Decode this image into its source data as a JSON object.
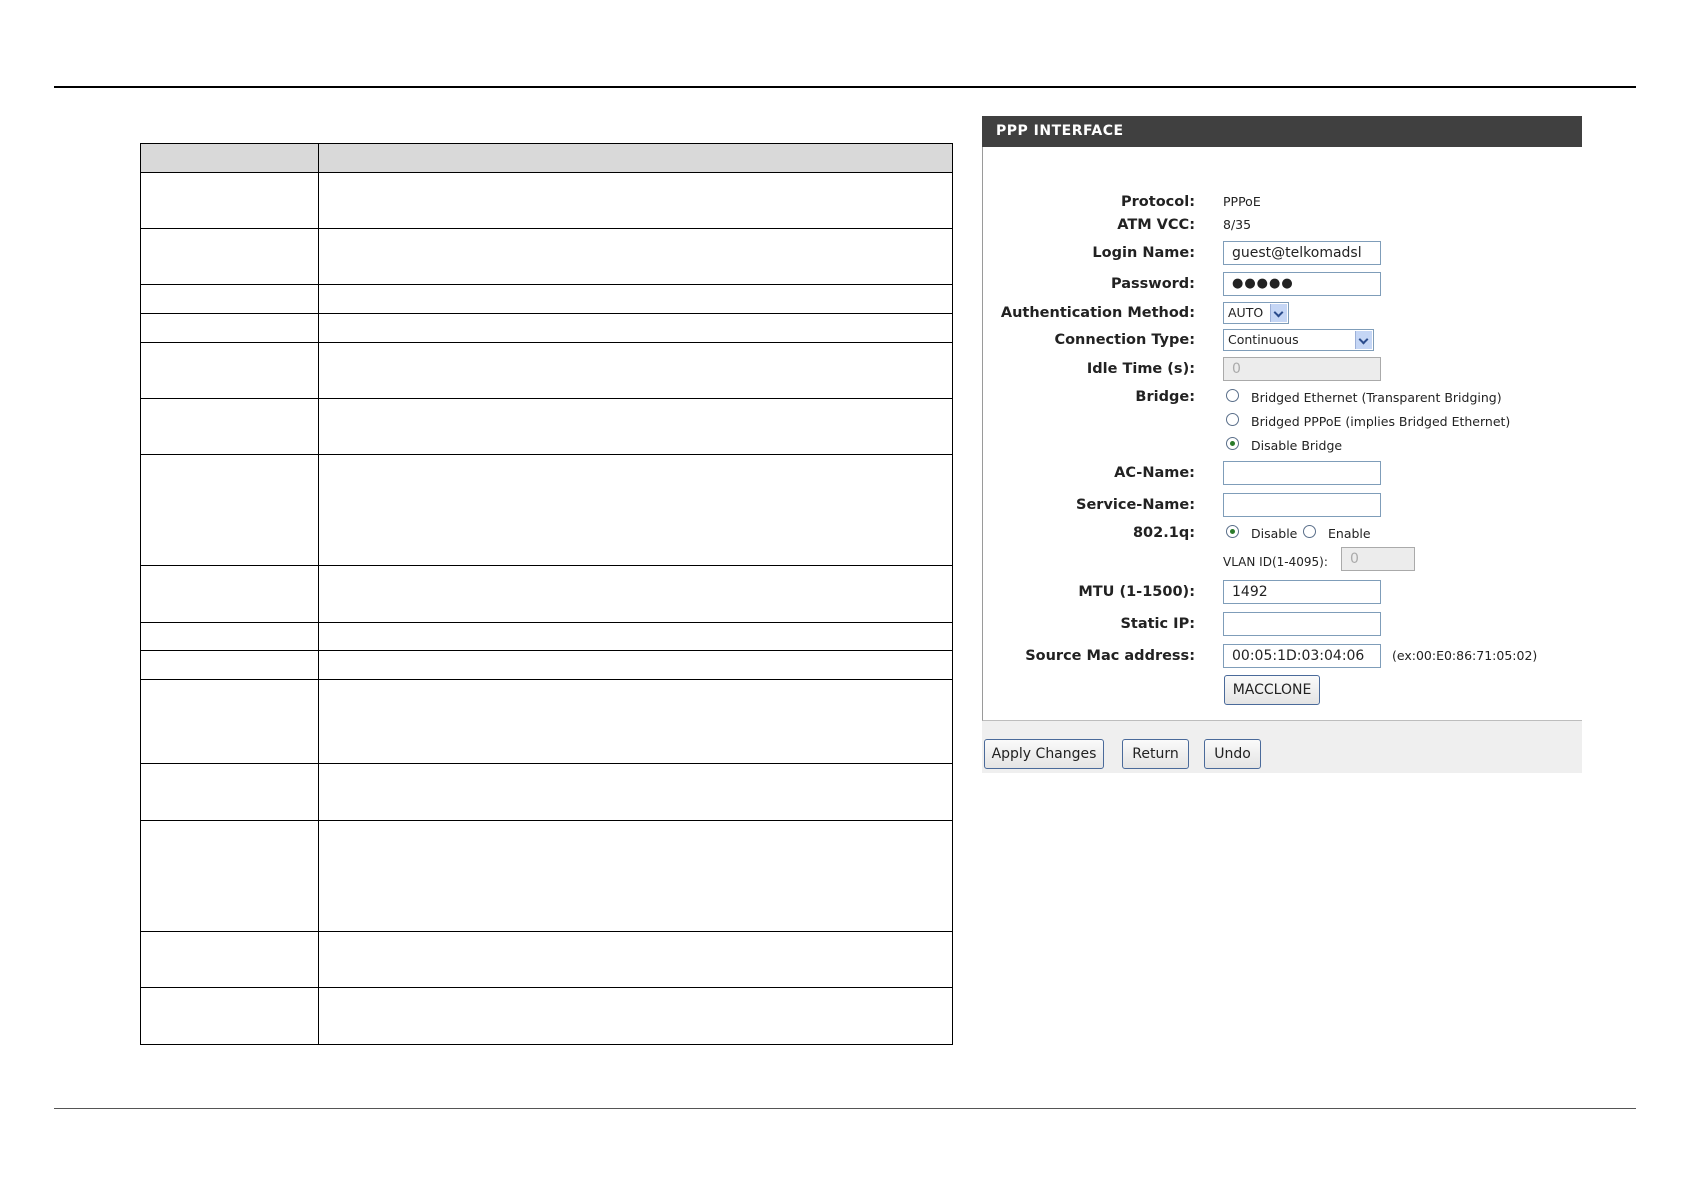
{
  "panel": {
    "title": "PPP INTERFACE",
    "protocol": {
      "label": "Protocol:",
      "value": "PPPoE"
    },
    "atm_vcc": {
      "label": "ATM VCC:",
      "value": "8/35"
    },
    "login_name": {
      "label": "Login Name:",
      "value": "guest@telkomadsl"
    },
    "password": {
      "label": "Password:",
      "value": "●●●●●"
    },
    "auth_method": {
      "label": "Authentication Method:",
      "value": "AUTO"
    },
    "connection_type": {
      "label": "Connection Type:",
      "value": "Continuous"
    },
    "idle_time": {
      "label": "Idle Time (s):",
      "value": "0"
    },
    "bridge": {
      "label": "Bridge:",
      "options": [
        "Bridged Ethernet (Transparent Bridging)",
        "Bridged PPPoE (implies Bridged Ethernet)",
        "Disable Bridge"
      ],
      "selected": 2
    },
    "ac_name": {
      "label": "AC-Name:",
      "value": ""
    },
    "service_name": {
      "label": "Service-Name:",
      "value": ""
    },
    "dot1q": {
      "label": "802.1q:",
      "disable": "Disable",
      "enable": "Enable",
      "selected": "Disable"
    },
    "vlan_id": {
      "label": "VLAN ID(1-4095):",
      "value": "0"
    },
    "mtu": {
      "label": "MTU (1-1500):",
      "value": "1492"
    },
    "static_ip": {
      "label": "Static IP:",
      "value": ""
    },
    "source_mac": {
      "label": "Source Mac address:",
      "value": "00:05:1D:03:04:06",
      "example": "(ex:00:E0:86:71:05:02)"
    },
    "macclone_label": "MACCLONE"
  },
  "buttons": {
    "apply": "Apply Changes",
    "return": "Return",
    "undo": "Undo"
  }
}
